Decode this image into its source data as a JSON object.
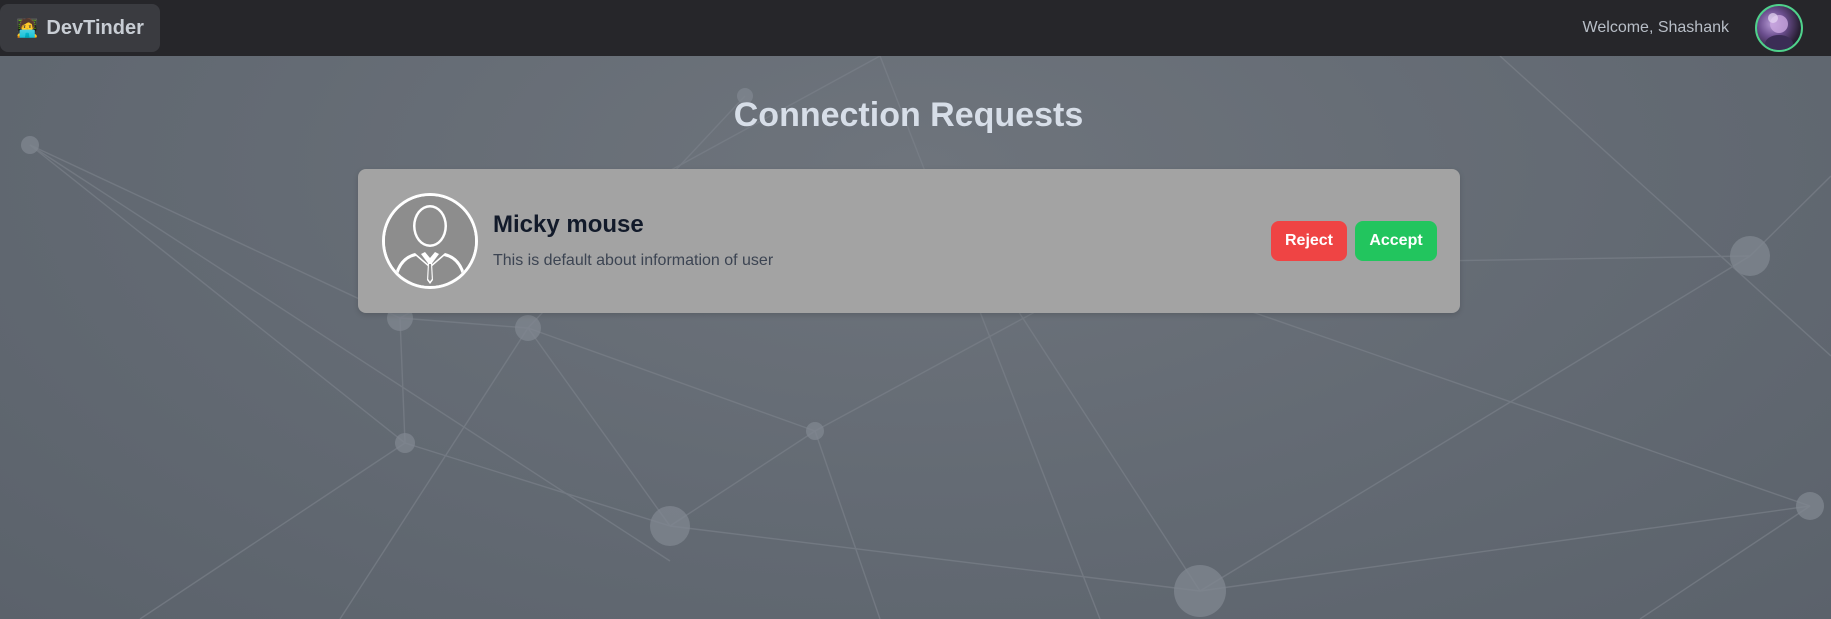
{
  "navbar": {
    "brand_icon": "🧑‍💻",
    "brand_label": "DevTinder",
    "welcome_text": "Welcome, Shashank",
    "avatar_icon": "user-avatar"
  },
  "page": {
    "title": "Connection Requests"
  },
  "requests": [
    {
      "name": "Micky mouse",
      "about": "This is default about information of user",
      "photo_icon": "default-user-silhouette",
      "reject_label": "Reject",
      "accept_label": "Accept"
    }
  ],
  "colors": {
    "navbar_bg": "#26262a",
    "card_bg": "#a3a3a3",
    "reject": "#ef4444",
    "accept": "#22c55e",
    "avatar_border": "#4fd18b"
  }
}
